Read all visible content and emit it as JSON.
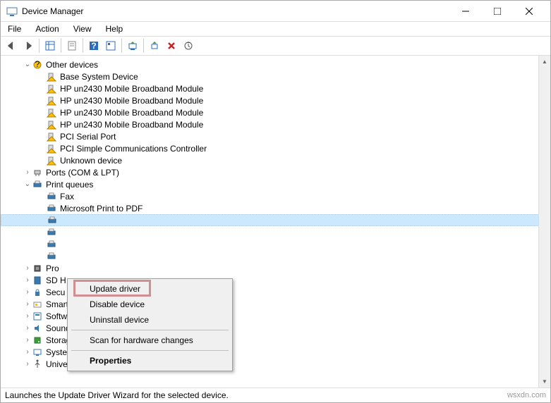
{
  "window": {
    "title": "Device Manager"
  },
  "menu": {
    "file": "File",
    "action": "Action",
    "view": "View",
    "help": "Help"
  },
  "tree": {
    "other_devices": {
      "label": "Other devices",
      "items": [
        "Base System Device",
        "HP un2430 Mobile Broadband Module",
        "HP un2430 Mobile Broadband Module",
        "HP un2430 Mobile Broadband Module",
        "HP un2430 Mobile Broadband Module",
        "PCI Serial Port",
        "PCI Simple Communications Controller",
        "Unknown device"
      ]
    },
    "ports": {
      "label": "Ports (COM & LPT)"
    },
    "print_queues": {
      "label": "Print queues",
      "items": [
        "Fax",
        "Microsoft Print to PDF",
        "",
        "",
        "",
        ""
      ]
    },
    "processors": {
      "label": "Pro"
    },
    "sd_host": {
      "label": "SD H"
    },
    "security": {
      "label": "Secu"
    },
    "smartcard": {
      "label": "Smart card readers"
    },
    "software": {
      "label": "Software devices"
    },
    "sound": {
      "label": "Sound, video and game controllers"
    },
    "storage": {
      "label": "Storage controllers"
    },
    "system": {
      "label": "System devices"
    },
    "usb": {
      "label": "Universal Serial Bus controllers"
    }
  },
  "context_menu": {
    "update": "Update driver",
    "disable": "Disable device",
    "uninstall": "Uninstall device",
    "scan": "Scan for hardware changes",
    "properties": "Properties"
  },
  "status": {
    "text": "Launches the Update Driver Wizard for the selected device."
  },
  "watermark": "wsxdn.com"
}
